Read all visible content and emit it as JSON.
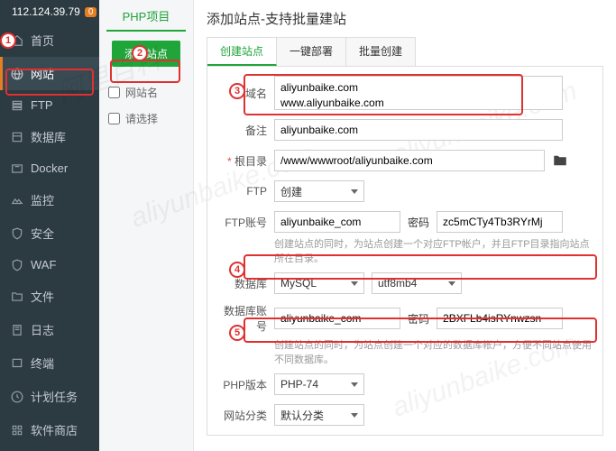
{
  "ip": "112.124.39.79",
  "badge": "0",
  "sidebar": [
    "首页",
    "网站",
    "FTP",
    "数据库",
    "Docker",
    "监控",
    "安全",
    "WAF",
    "文件",
    "日志",
    "终端",
    "计划任务",
    "软件商店"
  ],
  "mid": {
    "title": "PHP项目",
    "addBtn": "添加站点",
    "col1": "网站名",
    "col2": "请选择"
  },
  "dlgTitle": "添加站点-支持批量建站",
  "tabs": [
    "创建站点",
    "一键部署",
    "批量创建"
  ],
  "labels": {
    "domain": "域名",
    "remark": "备注",
    "root": "根目录",
    "ftp": "FTP",
    "ftpAcc": "FTP账号",
    "pwd": "密码",
    "db": "数据库",
    "dbAcc": "数据库账号",
    "phpVer": "PHP版本",
    "cat": "网站分类"
  },
  "vals": {
    "domain": "aliyunbaike.com\nwww.aliyunbaike.com",
    "remark": "aliyunbaike.com",
    "root": "/www/wwwroot/aliyunbaike.com",
    "ftpSel": "创建",
    "ftpUser": "aliyunbaike_com",
    "ftpPwd": "zc5mCTy4Tb3RYrMj",
    "dbSel": "MySQL",
    "charset": "utf8mb4",
    "dbUser": "aliyunbaike_com",
    "dbPwd": "2BXFLb4isRYnwzsn",
    "phpVer": "PHP-74",
    "cat": "默认分类"
  },
  "hints": {
    "ftp": "创建站点的同时，为站点创建一个对应FTP帐户，并且FTP目录指向站点所在目录。",
    "db": "创建站点的同时，为站点创建一个对应的数据库帐户，方便不同站点使用不同数据库。"
  }
}
